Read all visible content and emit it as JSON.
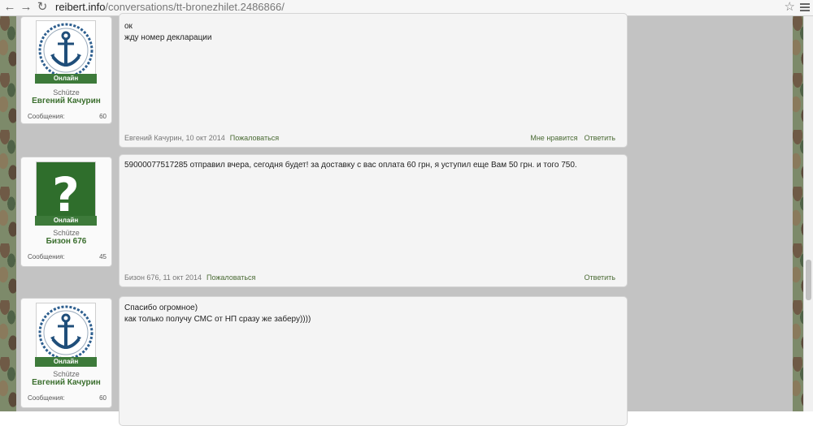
{
  "browser": {
    "url_domain": "reibert.info",
    "url_path": "/conversations/tt-bronezhilet.2486866/"
  },
  "posts": [
    {
      "user": {
        "online": "Онлайн",
        "rank": "Schütze",
        "name": "Евгений Качурин",
        "messages_label": "Сообщения:",
        "messages_count": "60",
        "avatar": "anchor-avatar"
      },
      "text": "ок\nжду номер декларации",
      "author_date": "Евгений Качурин, 10 окт 2014",
      "report": "Пожаловаться",
      "dislike": "Мне нравится",
      "reply": "Ответить"
    },
    {
      "user": {
        "online": "Онлайн",
        "rank": "Schütze",
        "name": "Бизон 676",
        "messages_label": "Сообщения:",
        "messages_count": "45",
        "avatar": "question-mark-avatar"
      },
      "text": "59000077517285 отправил вчера, сегодня будет! за доставку с вас оплата 60 грн, я уступил еще Вам 50 грн. и того 750.",
      "author_date": "Бизон 676, 11 окт 2014",
      "report": "Пожаловаться",
      "reply": "Ответить"
    },
    {
      "user": {
        "online": "Онлайн",
        "rank": "Schütze",
        "name": "Евгений Качурин",
        "messages_label": "Сообщения:",
        "messages_count": "60",
        "avatar": "anchor-avatar"
      },
      "text": "Спасибо огромное)\nкак только получу СМС от НП сразу же заберу))))"
    }
  ],
  "colors": {
    "online_badge": "#3d7a3a",
    "username": "#3a6e2d",
    "link": "#4a6a34",
    "content_bg": "#c3c3c3"
  }
}
